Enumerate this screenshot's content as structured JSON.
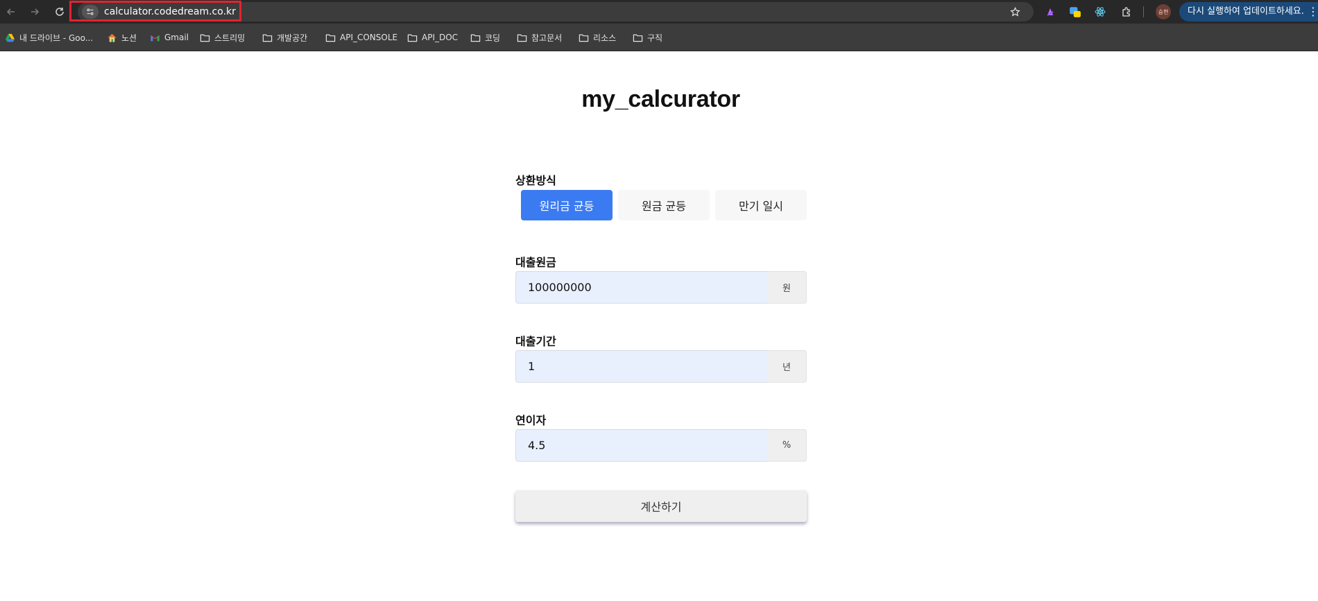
{
  "browser": {
    "url": "calculator.codedream.co.kr",
    "update_label": "다시 실행하여 업데이트하세요.",
    "avatar_text": "승현",
    "bookmarks": [
      {
        "label": "내 드라이브 - Goo...",
        "icon": "google-drive-icon"
      },
      {
        "label": "노션",
        "icon": "notion-house-icon"
      },
      {
        "label": "Gmail",
        "icon": "gmail-icon"
      },
      {
        "label": "스트리밍",
        "icon": "folder-icon"
      },
      {
        "label": "개발공간",
        "icon": "folder-icon"
      },
      {
        "label": "API_CONSOLE",
        "icon": "folder-icon"
      },
      {
        "label": "API_DOC",
        "icon": "folder-icon"
      },
      {
        "label": "코딩",
        "icon": "folder-icon"
      },
      {
        "label": "참고문서",
        "icon": "folder-icon"
      },
      {
        "label": "리소스",
        "icon": "folder-icon"
      },
      {
        "label": "구직",
        "icon": "folder-icon"
      }
    ],
    "colors": {
      "highlight": "#e3232f",
      "chrome": "#282828",
      "update_pill": "#1b4a7a"
    }
  },
  "page": {
    "title": "my_calcurator",
    "repayment": {
      "label": "상환방식",
      "options": [
        "원리금 균등",
        "원금 균등",
        "만기 일시"
      ],
      "selected": "원리금 균등"
    },
    "principal": {
      "label": "대출원금",
      "value": "100000000",
      "unit": "원"
    },
    "period": {
      "label": "대출기간",
      "value": "1",
      "unit": "년"
    },
    "interest": {
      "label": "연이자",
      "value": "4.5",
      "unit": "%"
    },
    "submit_label": "계산하기",
    "colors": {
      "accent": "#3b7bf2",
      "input_bg": "#e8f0fe"
    }
  }
}
